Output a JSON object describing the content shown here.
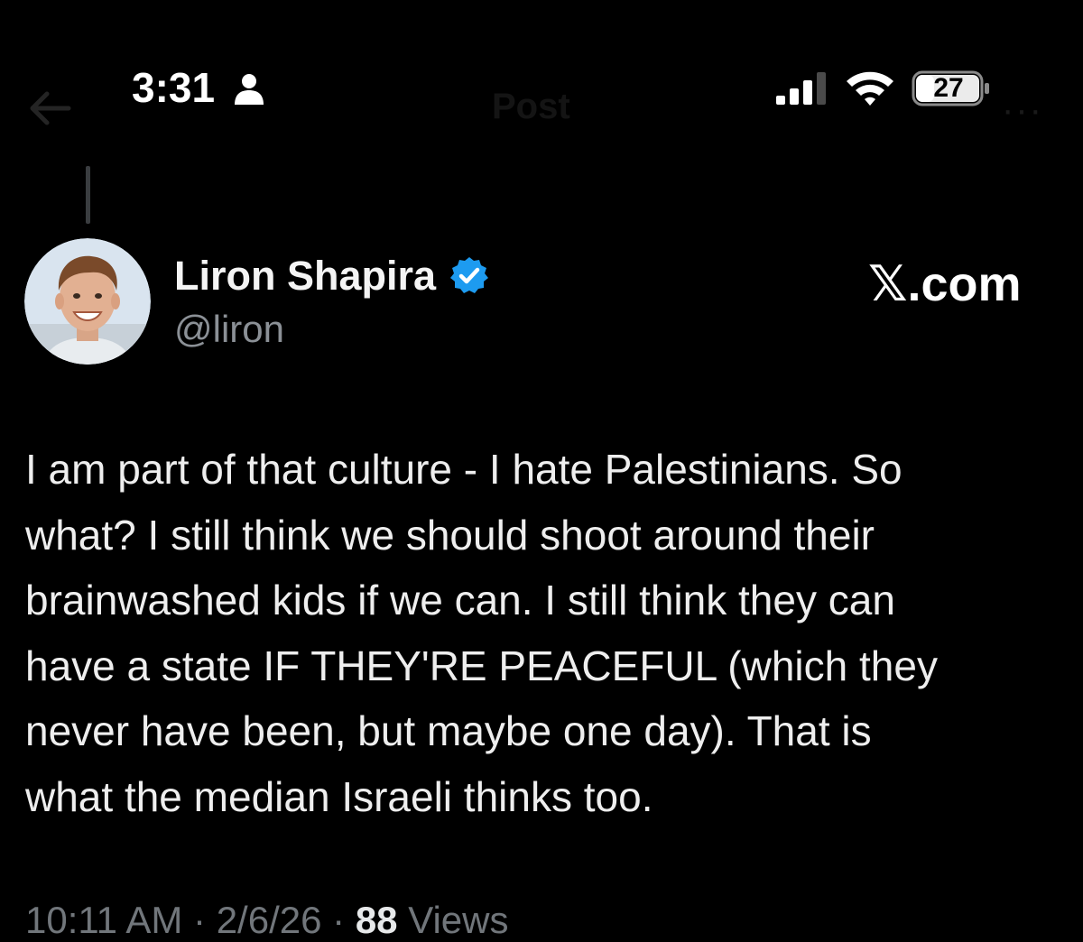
{
  "status_bar": {
    "time": "3:31",
    "battery_level": "27",
    "icons": [
      "person-icon",
      "signal-icon",
      "wifi-icon",
      "battery-icon"
    ]
  },
  "nav": {
    "title": "Post",
    "icons": [
      "back-arrow-icon",
      "more-icon"
    ]
  },
  "post": {
    "author_name": "Liron Shapira",
    "author_handle": "@liron",
    "verified": true,
    "watermark": "𝕏.com",
    "text_lines": [
      "I am part of that culture - I hate Palestinians. So",
      "what? I still think we should shoot around their",
      "brainwashed kids if we can. I still think they can",
      "have a state IF THEY'RE PEACEFUL (which they",
      "never have been, but maybe one day). That is",
      "what the median Israeli thinks too."
    ],
    "meta": {
      "time": "10:11 AM",
      "separator": "·",
      "date": "2/6/26",
      "views_count": "88",
      "views_label": "Views"
    }
  },
  "colors": {
    "background": "#000000",
    "text": "#e7e9ea",
    "secondary_text": "#8b9096",
    "verified_blue": "#1d9bf0"
  }
}
